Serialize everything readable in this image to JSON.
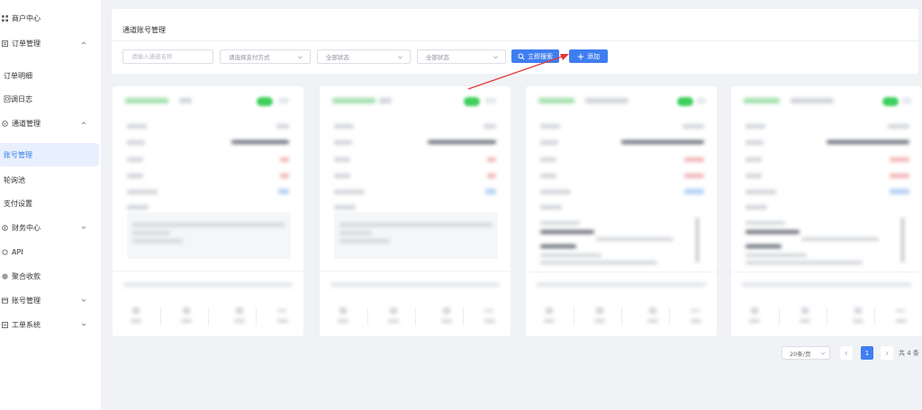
{
  "sidebar": {
    "items": [
      {
        "label": "商户中心",
        "icon": "grid-icon"
      },
      {
        "label": "订单管理",
        "icon": "list-icon",
        "expanded": true
      },
      {
        "label": "订单明细"
      },
      {
        "label": "回调日志"
      },
      {
        "label": "通道管理",
        "icon": "channel-icon",
        "expanded": true
      },
      {
        "label": "账号管理",
        "active": true
      },
      {
        "label": "轮询池"
      },
      {
        "label": "支付设置"
      },
      {
        "label": "财务中心",
        "icon": "finance-icon",
        "expanded": false
      },
      {
        "label": "API",
        "icon": "api-icon"
      },
      {
        "label": "聚合收款",
        "icon": "aggregate-icon"
      },
      {
        "label": "账号管理",
        "icon": "account-icon",
        "expanded": false
      },
      {
        "label": "工单系统",
        "icon": "ticket-icon",
        "expanded": false
      }
    ]
  },
  "panel": {
    "title": "通道账号管理",
    "filters": {
      "name_placeholder": "请输入通道名称",
      "pay_method": "请选择支付方式",
      "status1": "全部状态",
      "status2": "全部状态"
    },
    "search_label": "立即搜索",
    "add_label": "添加"
  },
  "colors": {
    "accent": "#3f7ef0",
    "active_bg": "#e8f0fe",
    "toggle_on": "#3ecf5c",
    "arrow": "#e53935"
  },
  "pagination": {
    "page_size": "20条/页",
    "current_page": "1",
    "total": "共 4 条"
  }
}
